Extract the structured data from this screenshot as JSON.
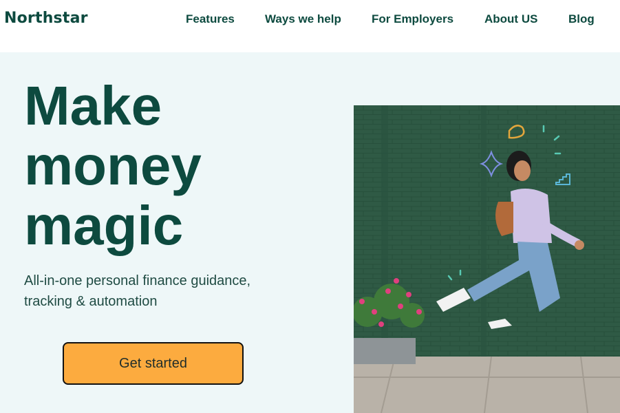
{
  "header": {
    "logo": "Northstar",
    "nav": [
      {
        "label": "Features"
      },
      {
        "label": "Ways we help"
      },
      {
        "label": "For Employers"
      },
      {
        "label": "About US"
      },
      {
        "label": "Blog"
      }
    ]
  },
  "hero": {
    "headline": [
      "Make",
      "money",
      "magic"
    ],
    "subtitle": [
      "All-in-one personal finance guidance,",
      "tracking & automation"
    ],
    "cta_label": "Get started"
  },
  "colors": {
    "brand": "#0d4a3f",
    "hero_background": "#eef7f8",
    "cta": "#fcab3f",
    "photo_wall": "#2f5a45"
  },
  "icons": [
    "sparkle-doodle-icon",
    "wavy-doodle-icon",
    "stair-doodle-icon"
  ]
}
